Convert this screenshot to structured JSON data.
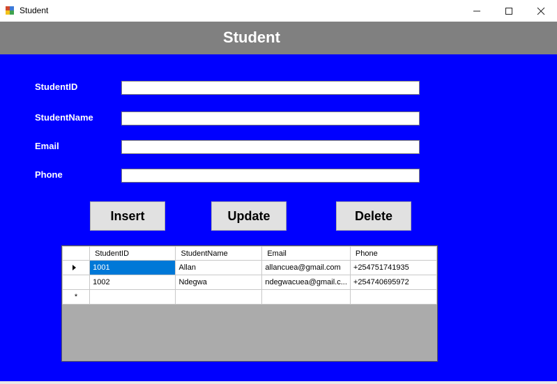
{
  "window": {
    "title": "Student"
  },
  "header": {
    "title": "Student"
  },
  "form": {
    "fields": [
      {
        "label": "StudentID",
        "value": ""
      },
      {
        "label": "StudentName",
        "value": ""
      },
      {
        "label": "Email",
        "value": ""
      },
      {
        "label": "Phone",
        "value": ""
      }
    ]
  },
  "buttons": {
    "insert": "Insert",
    "update": "Update",
    "delete": "Delete"
  },
  "grid": {
    "columns": [
      "StudentID",
      "StudentName",
      "Email",
      "Phone"
    ],
    "rows": [
      {
        "id": "1001",
        "name": "Allan",
        "email": "allancuea@gmail.com",
        "phone": "+254751741935"
      },
      {
        "id": "1002",
        "name": "Ndegwa",
        "email": "ndegwacuea@gmail.c...",
        "phone": "+254740695972"
      }
    ],
    "new_row_marker": "*"
  },
  "colors": {
    "background": "#0000ff",
    "header": "#808080",
    "selection": "#0078d7"
  },
  "icons": [
    "app-icon",
    "minimize-icon",
    "maximize-icon",
    "close-icon",
    "current-row-icon"
  ]
}
